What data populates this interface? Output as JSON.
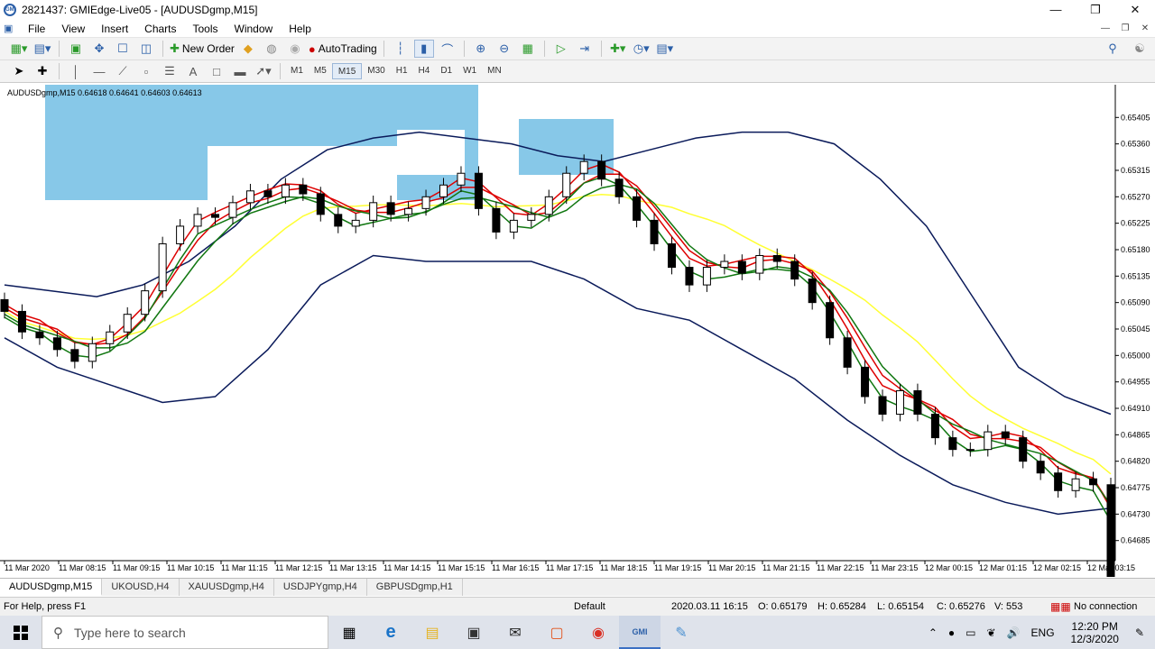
{
  "window": {
    "title": "2821437: GMIEdge-Live05 - [AUDUSDgmp,M15]",
    "logo_text": "GMI"
  },
  "menu": [
    "File",
    "View",
    "Insert",
    "Charts",
    "Tools",
    "Window",
    "Help"
  ],
  "toolbar": {
    "new_order_label": "New Order",
    "autotrading_label": "AutoTrading"
  },
  "timeframes": [
    "M1",
    "M5",
    "M15",
    "M30",
    "H1",
    "H4",
    "D1",
    "W1",
    "MN"
  ],
  "active_timeframe": "M15",
  "chart": {
    "info": "AUDUSDgmp,M15  0.64618 0.64641 0.64603 0.64613",
    "symbol": "AUDUSDgmp",
    "price_axis": [
      "0.65405",
      "0.65360",
      "0.65315",
      "0.65270",
      "0.65225",
      "0.65180",
      "0.65135",
      "0.65090",
      "0.65045",
      "0.65000",
      "0.64955",
      "0.64910",
      "0.64865",
      "0.64820",
      "0.64775",
      "0.64730",
      "0.64685"
    ],
    "time_axis": [
      "11 Mar 2020",
      "11 Mar 08:15",
      "11 Mar 09:15",
      "11 Mar 10:15",
      "11 Mar 11:15",
      "11 Mar 12:15",
      "11 Mar 13:15",
      "11 Mar 14:15",
      "11 Mar 15:15",
      "11 Mar 16:15",
      "11 Mar 17:15",
      "11 Mar 18:15",
      "11 Mar 19:15",
      "11 Mar 20:15",
      "11 Mar 21:15",
      "11 Mar 22:15",
      "11 Mar 23:15",
      "12 Mar 00:15",
      "12 Mar 01:15",
      "12 Mar 02:15",
      "12 Mar 03:15"
    ],
    "colors": {
      "zone": "#87c8e8",
      "bollinger": "#0a1a5a",
      "ma_red": "#dd0000",
      "ma_green": "#117711",
      "ma_yellow": "#ffff33"
    }
  },
  "chart_data": {
    "type": "candlestick",
    "symbol": "AUDUSDgmp",
    "timeframe": "M15",
    "last_bar": {
      "open": 0.64618,
      "high": 0.64641,
      "low": 0.64603,
      "close": 0.64613
    },
    "ylim": [
      0.6466,
      0.6543
    ],
    "close_series": [
      0.65075,
      0.6504,
      0.6503,
      0.6501,
      0.6499,
      0.6502,
      0.6504,
      0.6507,
      0.6511,
      0.6519,
      0.6522,
      0.6524,
      0.65235,
      0.6526,
      0.6528,
      0.6527,
      0.6529,
      0.65275,
      0.6524,
      0.6522,
      0.6523,
      0.6526,
      0.6524,
      0.6525,
      0.6527,
      0.6529,
      0.6531,
      0.6525,
      0.6521,
      0.6523,
      0.6524,
      0.6527,
      0.6531,
      0.6533,
      0.653,
      0.6527,
      0.6523,
      0.6519,
      0.6515,
      0.6512,
      0.6515,
      0.6516,
      0.6514,
      0.6517,
      0.6516,
      0.6513,
      0.6509,
      0.6503,
      0.6498,
      0.6493,
      0.649,
      0.6494,
      0.649,
      0.6486,
      0.6484,
      0.6484,
      0.6487,
      0.6486,
      0.6482,
      0.648,
      0.6477,
      0.6479,
      0.6478,
      0.64613
    ],
    "bollinger_upper": [
      0.6512,
      0.6511,
      0.651,
      0.6512,
      0.6516,
      0.6522,
      0.653,
      0.6535,
      0.6537,
      0.6538,
      0.6537,
      0.6536,
      0.6534,
      0.6533,
      0.6535,
      0.6537,
      0.6538,
      0.6538,
      0.6536,
      0.653,
      0.6522,
      0.651,
      0.6498,
      0.6493,
      0.649
    ],
    "bollinger_lower": [
      0.6503,
      0.6498,
      0.6495,
      0.6492,
      0.6493,
      0.6501,
      0.6512,
      0.6517,
      0.6516,
      0.6516,
      0.6516,
      0.6513,
      0.6508,
      0.6506,
      0.6501,
      0.6496,
      0.6489,
      0.6483,
      0.6478,
      0.6475,
      0.6473,
      0.6474
    ],
    "session_time": "2020.03.11 16:15",
    "session_ohlc": {
      "open": 0.65179,
      "high": 0.65284,
      "low": 0.65154,
      "close": 0.65276
    },
    "volume": 553
  },
  "tabs": [
    "AUDUSDgmp,M15",
    "UKOUSD,H4",
    "XAUUSDgmp,H4",
    "USDJPYgmp,H4",
    "GBPUSDgmp,H1"
  ],
  "status": {
    "help": "For Help, press F1",
    "profile": "Default",
    "time": "2020.03.11 16:15",
    "open": "O: 0.65179",
    "high": "H: 0.65284",
    "low": "L: 0.65154",
    "close": "C: 0.65276",
    "volume": "V: 553",
    "connection": "No connection"
  },
  "taskbar": {
    "search_placeholder": "Type here to search",
    "language": "ENG",
    "time": "12:20 PM",
    "date": "12/3/2020"
  }
}
